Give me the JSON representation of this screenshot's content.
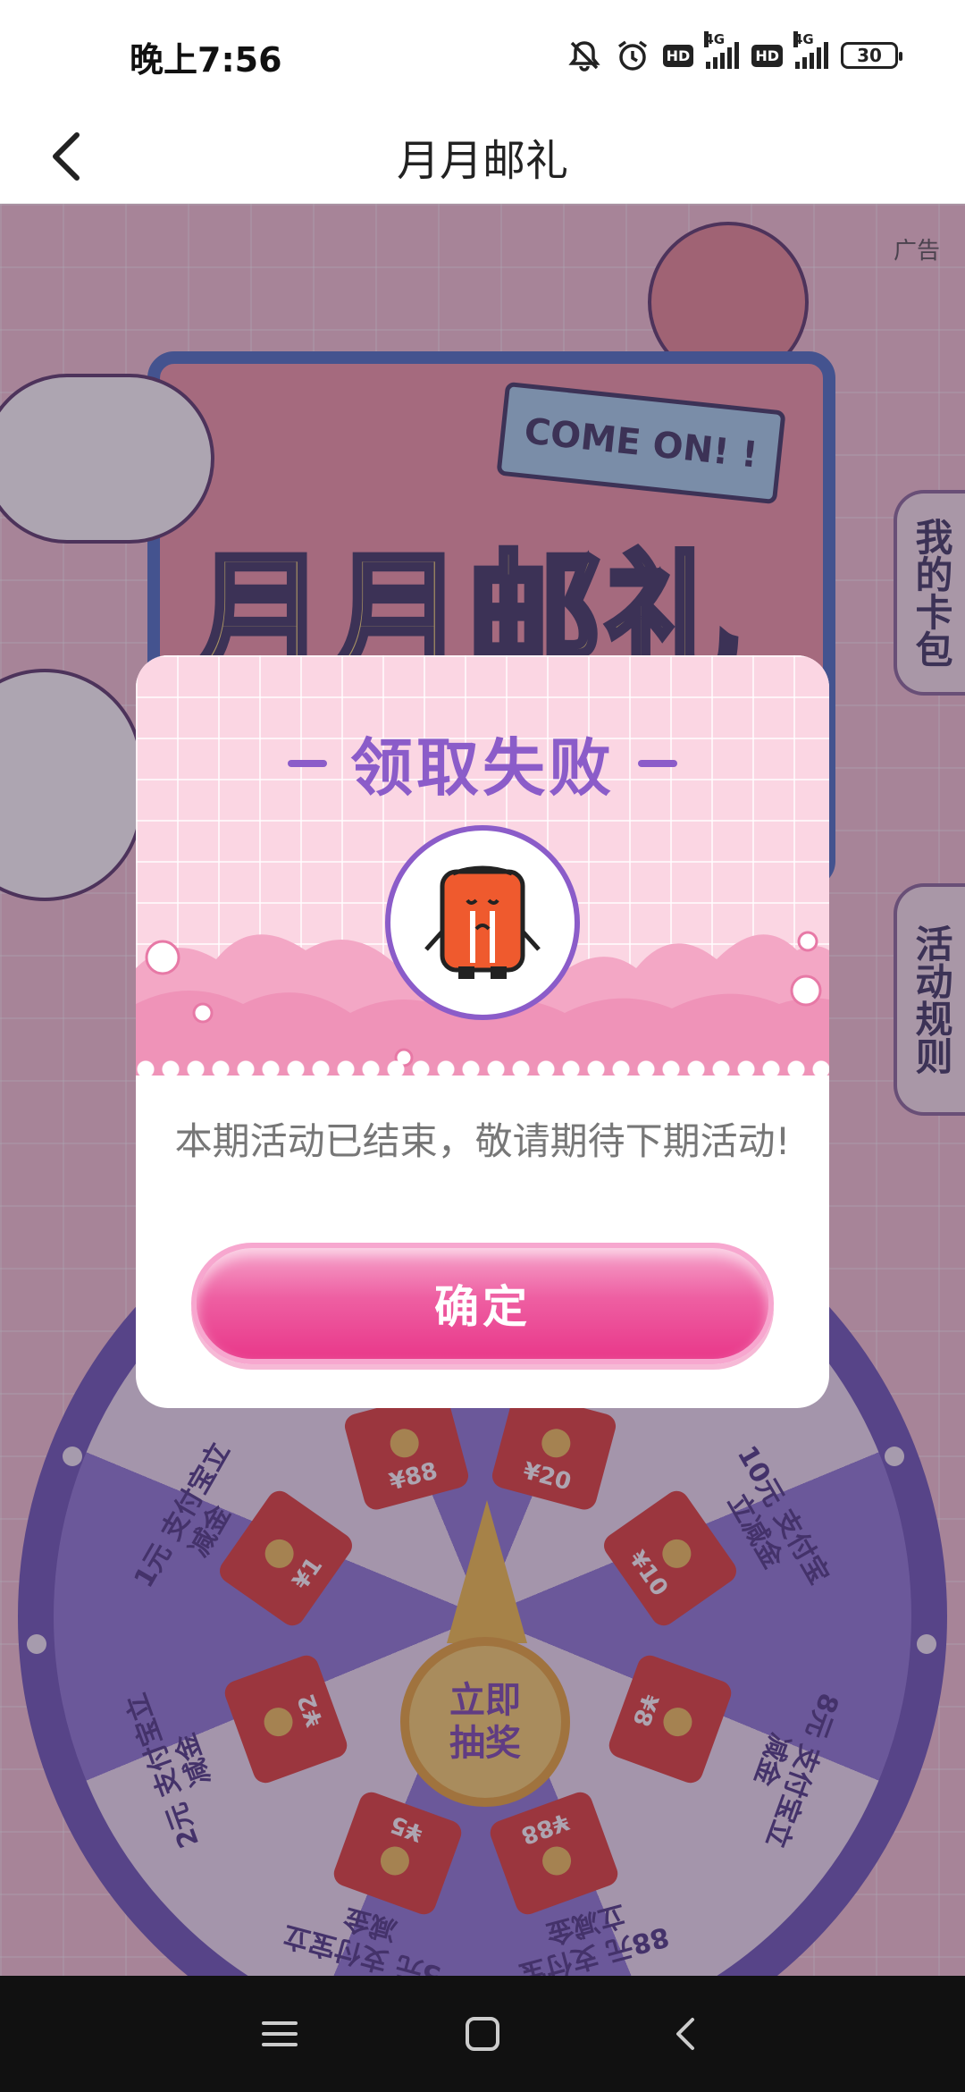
{
  "status_bar": {
    "time": "晚上7:56",
    "network_1": "4G",
    "network_2": "4G",
    "hd_1": "HD",
    "hd_2": "HD",
    "battery": "30"
  },
  "navbar": {
    "title": "月月邮礼",
    "back_icon": "chevron-left-icon"
  },
  "background": {
    "ad_label": "广告",
    "banner_title": "月月邮礼",
    "sign_text": "COME ON! !",
    "side_tabs": [
      "我的卡包",
      "活动规则"
    ],
    "wheel_center": "立即抽奖",
    "envelopes": [
      "¥88",
      "¥20",
      "¥10",
      "¥8",
      "¥88",
      "¥5",
      "¥2",
      "¥1"
    ],
    "prize_labels": [
      "1元 支付宝立减金",
      "10元 支付宝立减金",
      "8元 支付宝立减金",
      "88元 支付宝立减金",
      "5元 支付宝立减金",
      "2元 支付宝立减金"
    ]
  },
  "dialog": {
    "title": "领取失败",
    "message": "本期活动已结束，敬请期待下期活动!",
    "confirm_label": "确定"
  },
  "system_nav": {
    "menu_icon": "menu-icon",
    "home_icon": "home-square-icon",
    "back_icon": "back-triangle-icon"
  },
  "colors": {
    "accent_purple": "#8b5cc9",
    "button_pink": "#e9388a",
    "dialog_bg_pink": "#fbd6e3"
  }
}
